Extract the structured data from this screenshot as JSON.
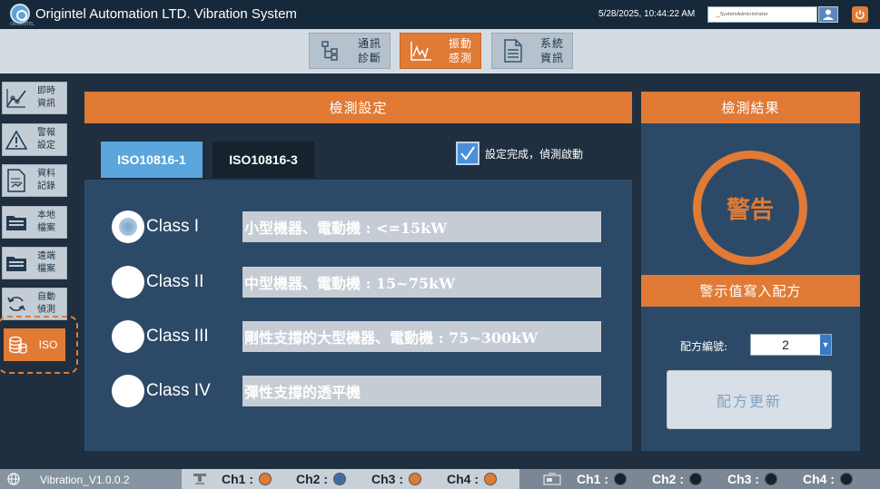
{
  "app": {
    "title": "Origintel Automation LTD. Vibration System",
    "logo_caption": "ORIGINTEL",
    "datetime": "5/28/2025, 10:44:22 AM",
    "user": "__SystemAdministrator"
  },
  "topnav": {
    "tabs": [
      {
        "label_top": "通訊",
        "label_bottom": "診斷",
        "icon": "network-tree-icon",
        "active": false
      },
      {
        "label_top": "振動",
        "label_bottom": "感測",
        "icon": "waveform-icon",
        "active": true
      },
      {
        "label_top": "系統",
        "label_bottom": "資訊",
        "icon": "document-icon",
        "active": false
      }
    ]
  },
  "sidebar": {
    "items": [
      {
        "label_top": "即時",
        "label_bottom": "資訊",
        "icon": "trend-chart-icon"
      },
      {
        "label_top": "警報",
        "label_bottom": "設定",
        "icon": "warning-icon"
      },
      {
        "label_top": "資料",
        "label_bottom": "記錄",
        "icon": "log-icon"
      },
      {
        "label_top": "本地",
        "label_bottom": "檔案",
        "icon": "folder-icon"
      },
      {
        "label_top": "遠端",
        "label_bottom": "檔案",
        "icon": "remote-folder-icon"
      },
      {
        "label_top": "自動",
        "label_bottom": "偵測",
        "icon": "refresh-icon"
      },
      {
        "label": "ISO",
        "icon": "coins-icon",
        "active": true
      }
    ]
  },
  "settings": {
    "title": "檢測設定",
    "tabs": [
      {
        "label": "ISO10816-1",
        "active": true
      },
      {
        "label": "ISO10816-3",
        "active": false
      }
    ],
    "confirm_checked": true,
    "confirm_label": "設定完成，偵測啟動",
    "classes": [
      {
        "name": "Class I",
        "desc": "小型機器、電動機 : <=15kW",
        "selected": true
      },
      {
        "name": "Class II",
        "desc": "中型機器、電動機 : 15~75kW",
        "selected": false
      },
      {
        "name": "Class III",
        "desc": "剛性支撐的大型機器、電動機 : 75~300kW",
        "selected": false
      },
      {
        "name": "Class IV",
        "desc": "彈性支撐的透平機",
        "selected": false
      }
    ]
  },
  "results": {
    "title": "檢測結果",
    "status": "警告",
    "write_header": "警示值寫入配方",
    "recipe_label": "配方編號:",
    "recipe_value": "2",
    "update_button": "配方更新"
  },
  "statusbar": {
    "version": "Vibration_V1.0.0.2",
    "group1": [
      {
        "label": "Ch1 :",
        "color": "#e07a35"
      },
      {
        "label": "Ch2 :",
        "color": "#3f6e9e"
      },
      {
        "label": "Ch3 :",
        "color": "#e07a35"
      },
      {
        "label": "Ch4 :",
        "color": "#e07a35"
      }
    ],
    "group2": [
      {
        "label": "Ch1 :",
        "color": "#16222e"
      },
      {
        "label": "Ch2 :",
        "color": "#16222e"
      },
      {
        "label": "Ch3 :",
        "color": "#16222e"
      },
      {
        "label": "Ch4 :",
        "color": "#16222e"
      }
    ]
  },
  "colors": {
    "accent": "#e07a35",
    "panel": "#2c4a68",
    "background": "#1f2f3f",
    "tab_active": "#5aa6dd"
  }
}
